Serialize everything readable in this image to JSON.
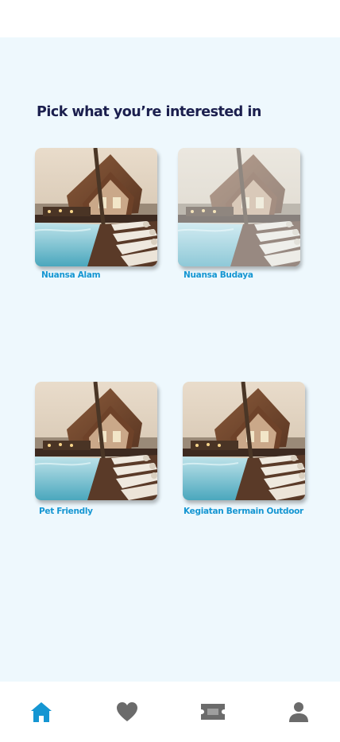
{
  "page": {
    "heading": "Pick what you’re interested in"
  },
  "categories": [
    {
      "label": "Nuansa Alam",
      "image": "resort-pool-photo",
      "dimmed": false
    },
    {
      "label": "Nuansa Budaya",
      "image": "resort-pool-photo",
      "dimmed": true
    },
    {
      "label": "Pet Friendly",
      "image": "resort-pool-photo",
      "dimmed": false
    },
    {
      "label": "Kegiatan Bermain Outdoor",
      "image": "resort-pool-photo",
      "dimmed": false
    }
  ],
  "bottom_nav": [
    {
      "name": "home",
      "icon": "home-icon",
      "active": true
    },
    {
      "name": "favorites",
      "icon": "heart-icon",
      "active": false
    },
    {
      "name": "tickets",
      "icon": "ticket-icon",
      "active": false
    },
    {
      "name": "profile",
      "icon": "person-icon",
      "active": false
    }
  ],
  "colors": {
    "background": "#eef8fd",
    "heading": "#1b1f4e",
    "label": "#1596d2",
    "nav_active": "#1596d2",
    "nav_inactive": "#6b6b6b"
  }
}
